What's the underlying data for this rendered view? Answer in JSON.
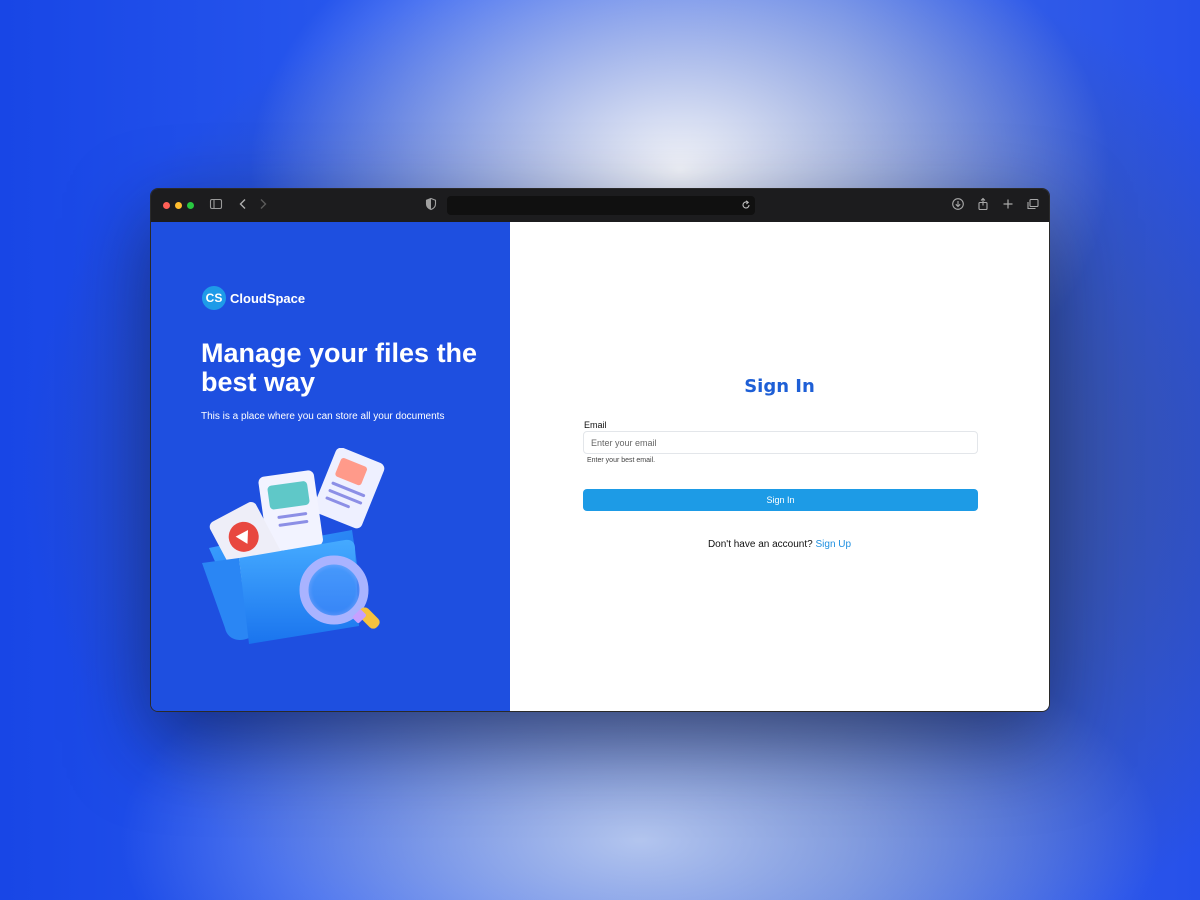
{
  "brand": {
    "initials": "CS",
    "name": "CloudSpace"
  },
  "hero": {
    "headline": "Manage your files the best way",
    "subtitle": "This is a place where you can store all your documents"
  },
  "form": {
    "title": "Sign In",
    "email_label": "Email",
    "email_placeholder": "Enter your email",
    "email_value": "",
    "email_hint": "Enter your best email.",
    "submit_label": "Sign In",
    "signup_prompt": "Don't have an account?",
    "signup_link": "Sign Up"
  },
  "colors": {
    "left_panel": "#1e4fe0",
    "accent": "#1d9be6",
    "title": "#1e5fd6"
  },
  "browser": {
    "toolbar_icons": [
      "sidebar-icon",
      "back-icon",
      "forward-icon",
      "shield-icon",
      "reload-icon",
      "download-icon",
      "share-icon",
      "new-tab-icon",
      "tabs-overview-icon"
    ]
  }
}
